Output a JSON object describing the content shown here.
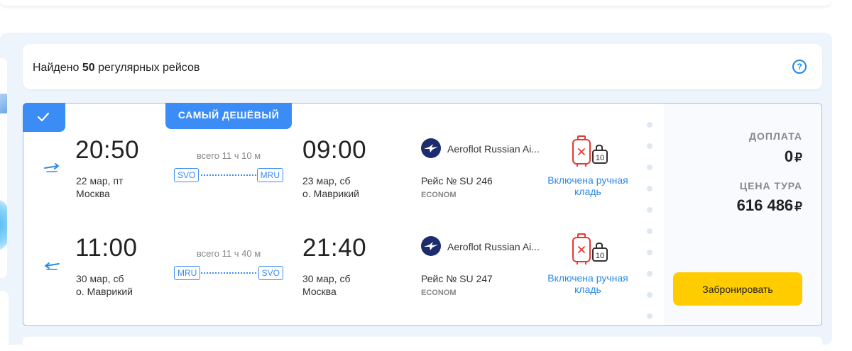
{
  "summary": {
    "prefix": "Найдено",
    "count": "50",
    "suffix": "регулярных рейсов"
  },
  "offer": {
    "cheapest_tag": "САМЫЙ ДЕШЁВЫЙ",
    "segments": [
      {
        "direction": "outbound",
        "dep_time": "20:50",
        "dep_date": "22 мар, пт",
        "dep_city": "Москва",
        "duration": "всего 11 ч 10 м",
        "from_code": "SVO",
        "to_code": "MRU",
        "arr_time": "09:00",
        "arr_date": "23 мар, сб",
        "arr_city": "о. Маврикий",
        "airline": "Aeroflot Russian Ai...",
        "flight": "Рейс № SU 246",
        "cabin": "ECONOM",
        "baggage_line1": "Включена ручная",
        "baggage_line2": "кладь",
        "baggage_weight": "10"
      },
      {
        "direction": "return",
        "dep_time": "11:00",
        "dep_date": "30 мар, сб",
        "dep_city": "о. Маврикий",
        "duration": "всего 11 ч 40 м",
        "from_code": "MRU",
        "to_code": "SVO",
        "arr_time": "21:40",
        "arr_date": "30 мар, сб",
        "arr_city": "Москва",
        "airline": "Aeroflot Russian Ai...",
        "flight": "Рейс № SU 247",
        "cabin": "ECONOM",
        "baggage_line1": "Включена ручная",
        "baggage_line2": "кладь",
        "baggage_weight": "10"
      }
    ],
    "price": {
      "extra_label": "ДОПЛАТА",
      "extra_value": "0",
      "tour_label": "ЦЕНА ТУРА",
      "tour_value": "616 486",
      "currency": "₽"
    },
    "book_label": "Забронировать"
  },
  "colors": {
    "accent": "#3b8cf5",
    "book_button": "#ffcc00",
    "baggage_icon": "#e53935",
    "baggage_text": "#2e8ae6"
  },
  "icons": {
    "check": "check-icon",
    "help": "question-circle-icon",
    "outbound": "plane-takeoff-icon",
    "return": "plane-return-icon",
    "airline_logo": "aeroflot-logo-icon",
    "baggage": "hand-luggage-icon"
  }
}
